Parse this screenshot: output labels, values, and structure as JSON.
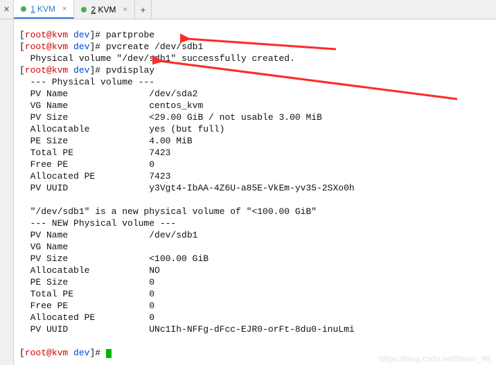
{
  "tabs": {
    "items": [
      {
        "label": "1 KVM",
        "dot": "green",
        "active": true
      },
      {
        "label": "2 KVM",
        "dot": "green",
        "active": false
      }
    ]
  },
  "prompt": {
    "user": "root",
    "host": "kvm",
    "path": "dev",
    "symbol": "#"
  },
  "terminal": {
    "lines": [
      {
        "type": "prompt",
        "cmd": "partprobe"
      },
      {
        "type": "prompt",
        "cmd": "pvcreate /dev/sdb1"
      },
      {
        "type": "out",
        "text": "  Physical volume \"/dev/sdb1\" successfully created."
      },
      {
        "type": "prompt",
        "cmd": "pvdisplay"
      },
      {
        "type": "out",
        "text": "  --- Physical volume ---"
      },
      {
        "type": "kv",
        "k": "  PV Name",
        "v": "/dev/sda2"
      },
      {
        "type": "kv",
        "k": "  VG Name",
        "v": "centos_kvm"
      },
      {
        "type": "kv",
        "k": "  PV Size",
        "v": "<29.00 GiB / not usable 3.00 MiB"
      },
      {
        "type": "kv",
        "k": "  Allocatable",
        "v": "yes (but full)"
      },
      {
        "type": "kv",
        "k": "  PE Size",
        "v": "4.00 MiB"
      },
      {
        "type": "kv",
        "k": "  Total PE",
        "v": "7423"
      },
      {
        "type": "kv",
        "k": "  Free PE",
        "v": "0"
      },
      {
        "type": "kv",
        "k": "  Allocated PE",
        "v": "7423"
      },
      {
        "type": "kv",
        "k": "  PV UUID",
        "v": "y3Vgt4-IbAA-4Z6U-a85E-VkEm-yv35-2SXo0h"
      },
      {
        "type": "out",
        "text": "   "
      },
      {
        "type": "out",
        "text": "  \"/dev/sdb1\" is a new physical volume of \"<100.00 GiB\""
      },
      {
        "type": "out",
        "text": "  --- NEW Physical volume ---"
      },
      {
        "type": "kv",
        "k": "  PV Name",
        "v": "/dev/sdb1"
      },
      {
        "type": "kv",
        "k": "  VG Name",
        "v": ""
      },
      {
        "type": "kv",
        "k": "  PV Size",
        "v": "<100.00 GiB"
      },
      {
        "type": "kv",
        "k": "  Allocatable",
        "v": "NO"
      },
      {
        "type": "kv",
        "k": "  PE Size",
        "v": "0   "
      },
      {
        "type": "kv",
        "k": "  Total PE",
        "v": "0"
      },
      {
        "type": "kv",
        "k": "  Free PE",
        "v": "0"
      },
      {
        "type": "kv",
        "k": "  Allocated PE",
        "v": "0"
      },
      {
        "type": "kv",
        "k": "  PV UUID",
        "v": "UNc1Ih-NFFg-dFcc-EJR0-orFt-8du0-inuLmi"
      },
      {
        "type": "out",
        "text": "   "
      },
      {
        "type": "prompt",
        "cmd": "",
        "cursor": true
      }
    ]
  },
  "kv_col": 24,
  "watermark": "https://blog.csdn.net/helan_99"
}
